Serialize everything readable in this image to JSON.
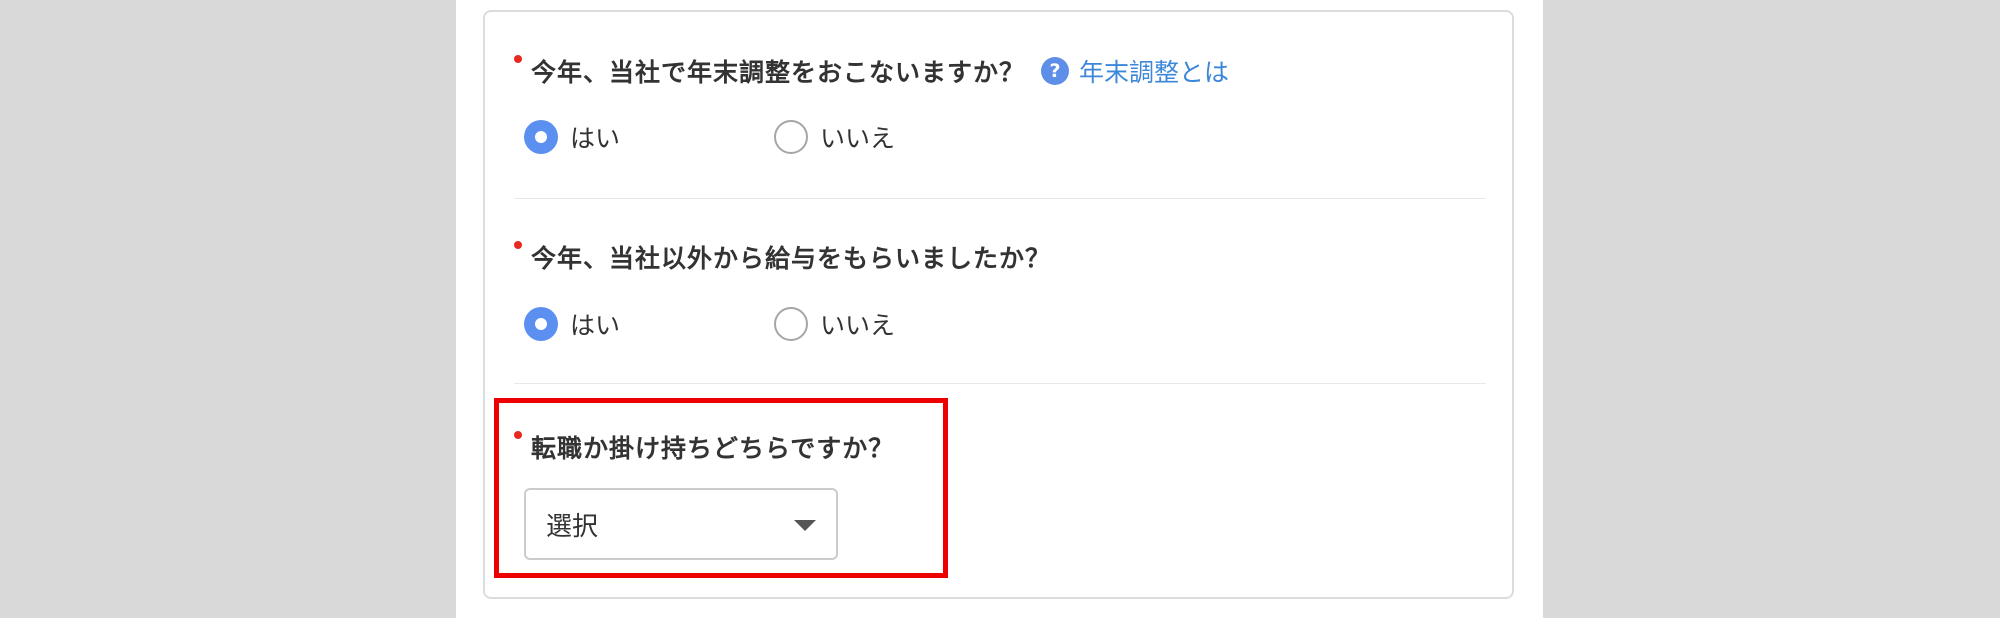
{
  "questions": [
    {
      "label": "今年、当社で年末調整をおこないますか？",
      "help_link": "年末調整とは",
      "help_icon": "question-circle-icon",
      "options": [
        {
          "label": "はい",
          "selected": true
        },
        {
          "label": "いいえ",
          "selected": false
        }
      ]
    },
    {
      "label": "今年、当社以外から給与をもらいましたか？",
      "options": [
        {
          "label": "はい",
          "selected": true
        },
        {
          "label": "いいえ",
          "selected": false
        }
      ]
    },
    {
      "label": "転職か掛け持ちどちらですか？",
      "select": {
        "value": "選択"
      }
    }
  ],
  "colors": {
    "required_marker": "#e8281e",
    "accent": "#5b8ff0",
    "link": "#3d87d9",
    "highlight": "#ee0000"
  }
}
